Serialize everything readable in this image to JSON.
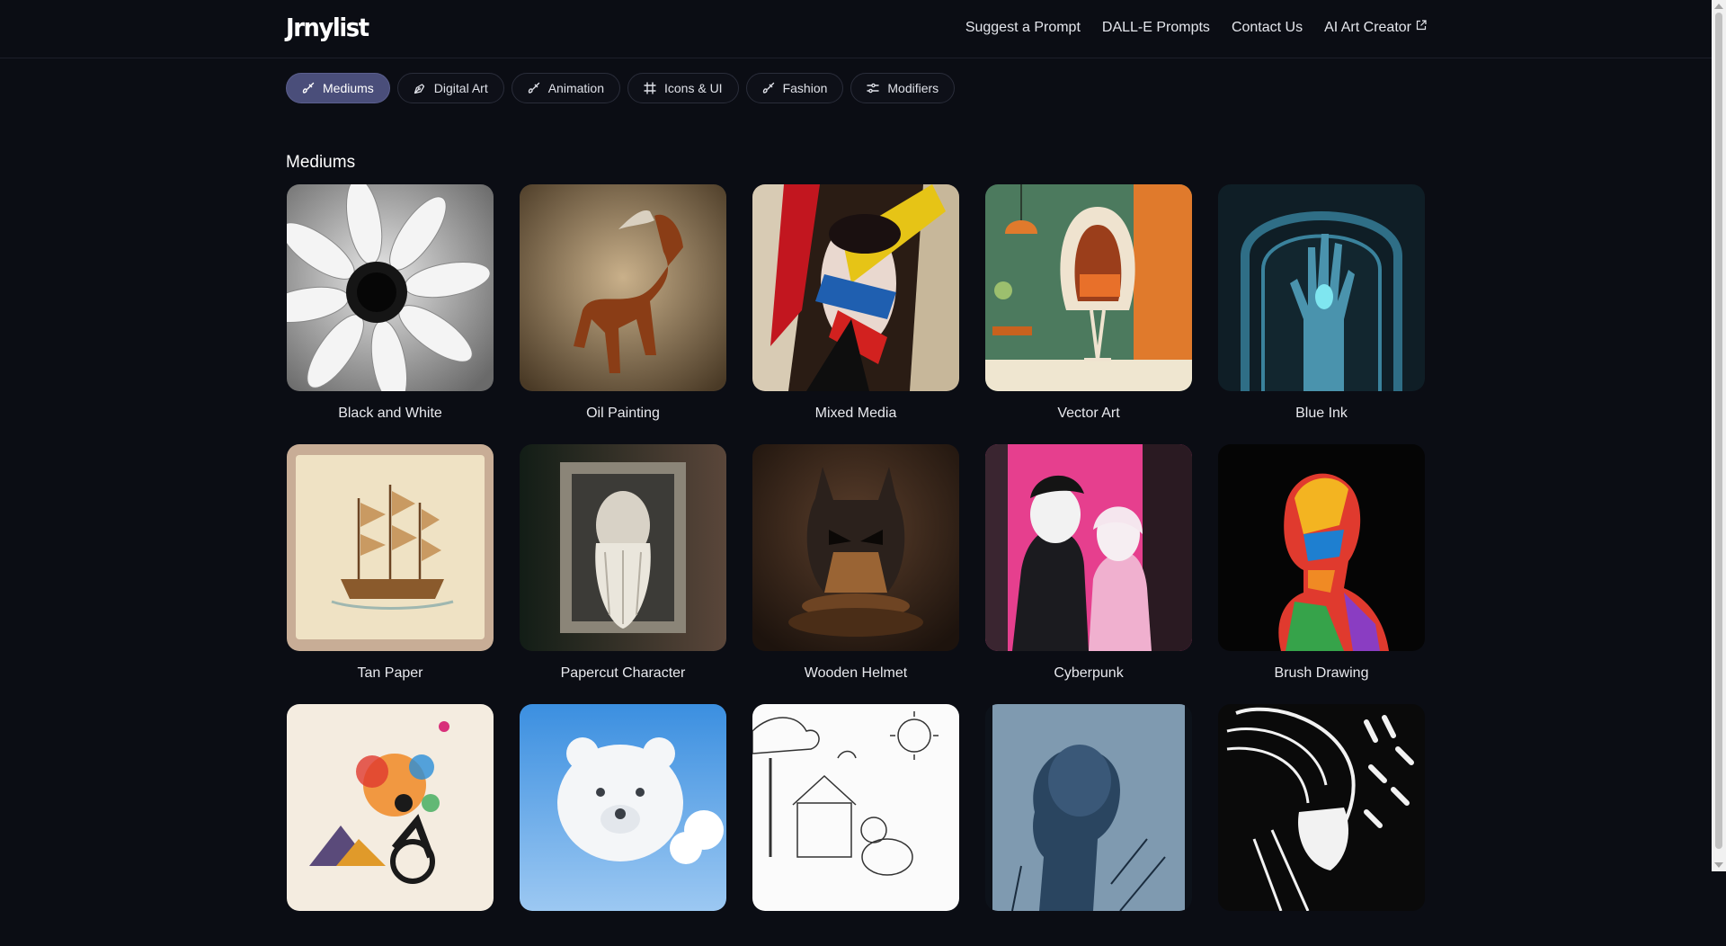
{
  "brand": {
    "logo": "Jrnylist"
  },
  "nav": [
    {
      "label": "Suggest a Prompt"
    },
    {
      "label": "DALL-E Prompts"
    },
    {
      "label": "Contact Us"
    },
    {
      "label": "AI Art Creator",
      "icon": "external-link-icon"
    }
  ],
  "categories": [
    {
      "label": "Mediums",
      "icon": "brush-icon",
      "active": true
    },
    {
      "label": "Digital Art",
      "icon": "pen-tool-icon",
      "active": false
    },
    {
      "label": "Animation",
      "icon": "brush-icon",
      "active": false
    },
    {
      "label": "Icons & UI",
      "icon": "frame-icon",
      "active": false
    },
    {
      "label": "Fashion",
      "icon": "brush-icon",
      "active": false
    },
    {
      "label": "Modifiers",
      "icon": "sliders-icon",
      "active": false
    }
  ],
  "section": {
    "title": "Mediums"
  },
  "cards": [
    {
      "label": "Black and White"
    },
    {
      "label": "Oil Painting"
    },
    {
      "label": "Mixed Media"
    },
    {
      "label": "Vector Art"
    },
    {
      "label": "Blue Ink"
    },
    {
      "label": "Tan Paper"
    },
    {
      "label": "Papercut Character"
    },
    {
      "label": "Wooden Helmet"
    },
    {
      "label": "Cyberpunk"
    },
    {
      "label": "Brush Drawing"
    },
    {
      "label": ""
    },
    {
      "label": ""
    },
    {
      "label": ""
    },
    {
      "label": ""
    },
    {
      "label": ""
    }
  ],
  "colors": {
    "background": "#0b0d14",
    "active_pill": "#4a4e7a",
    "text": "#e8e9ee"
  }
}
